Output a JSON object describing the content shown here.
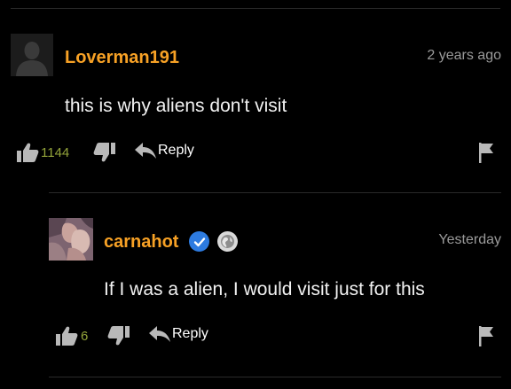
{
  "comments": [
    {
      "username": "Loverman191",
      "timestamp": "2 years ago",
      "text": "this is why aliens don't visit",
      "likes": "1144",
      "reply_label": "Reply"
    },
    {
      "username": "carnahot",
      "timestamp": "Yesterday",
      "text": "If I was a alien, I would visit just for this",
      "likes": "6",
      "reply_label": "Reply"
    }
  ],
  "colors": {
    "background": "#000000",
    "username": "#f7a125",
    "timestamp": "#9a9a9a",
    "like_count": "#93a33a",
    "verified_badge": "#2d7be0",
    "icons": "#b9b9b9"
  },
  "icons": [
    "default-avatar-icon",
    "thumbs-up-icon",
    "thumbs-down-icon",
    "reply-arrow-icon",
    "flag-icon",
    "verified-check-icon",
    "globe-badge-icon"
  ]
}
